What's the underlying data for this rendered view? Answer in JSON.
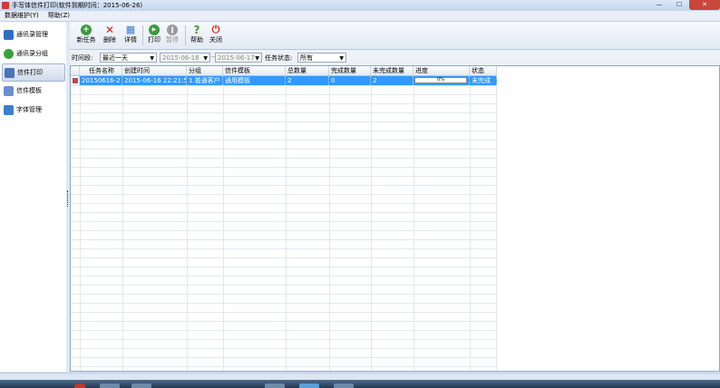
{
  "window": {
    "title": "手写体信件打印(软件到期时间：2015-06-26)",
    "controls": [
      "—",
      "☐",
      "✕"
    ]
  },
  "menu": [
    "数据维护(Y)",
    "帮助(Z)"
  ],
  "sidebar": {
    "items": [
      {
        "label": "通讯录管理",
        "icon": "address-book-icon",
        "color": "#2e6fc4"
      },
      {
        "label": "通讯录分组",
        "icon": "star-icon",
        "color": "#3aa23a"
      },
      {
        "label": "信件打印",
        "icon": "printer-icon",
        "color": "#4a73b8",
        "active": true
      },
      {
        "label": "信件模板",
        "icon": "envelope-icon",
        "color": "#6b8fd0"
      },
      {
        "label": "字体管理",
        "icon": "font-icon",
        "color": "#3a7fd0"
      }
    ]
  },
  "toolbar": {
    "new": {
      "label": "新任务",
      "icon": "plus-circle-icon",
      "color": "#3c9a3c",
      "glyph": "+"
    },
    "delete": {
      "label": "删除",
      "icon": "red-x-icon",
      "color": "#d0261d",
      "glyph": "✕"
    },
    "detail": {
      "label": "详情",
      "icon": "grid-detail-icon",
      "color": "#3c7cc4",
      "glyph": "▦"
    },
    "print": {
      "label": "打印",
      "icon": "play-circle-icon",
      "color": "#3c9a3c",
      "glyph": "▶"
    },
    "pause": {
      "label": "暂停",
      "icon": "pause-circle-icon",
      "color": "#9a9a9a",
      "glyph": "‖",
      "disabled": true
    },
    "help": {
      "label": "帮助",
      "icon": "question-icon",
      "color": "#3c9a3c",
      "glyph": "?"
    },
    "close": {
      "label": "关闭",
      "icon": "power-icon",
      "color": "#d0261d",
      "glyph": "⏻"
    }
  },
  "filter": {
    "period_label": "时间段:",
    "period_value": "最近一天",
    "date_from": "2015-06-16",
    "date_sep": "--",
    "date_to": "2015-06-17",
    "status_label": "任务状态:",
    "status_value": "所有"
  },
  "table": {
    "columns": [
      "任务名称",
      "创建时间",
      "分组",
      "信件模板",
      "总数量",
      "完成数量",
      "未完成数量",
      "进度",
      "状态"
    ],
    "rows": [
      {
        "name": "20150616-2",
        "created": "2015-06-16 22:21:59",
        "group": "1.普通客户",
        "template": "通用模板",
        "total": "2",
        "done": "0",
        "undone": "2",
        "progress_text": "0%",
        "progress": 0,
        "status": "未完成"
      }
    ]
  }
}
